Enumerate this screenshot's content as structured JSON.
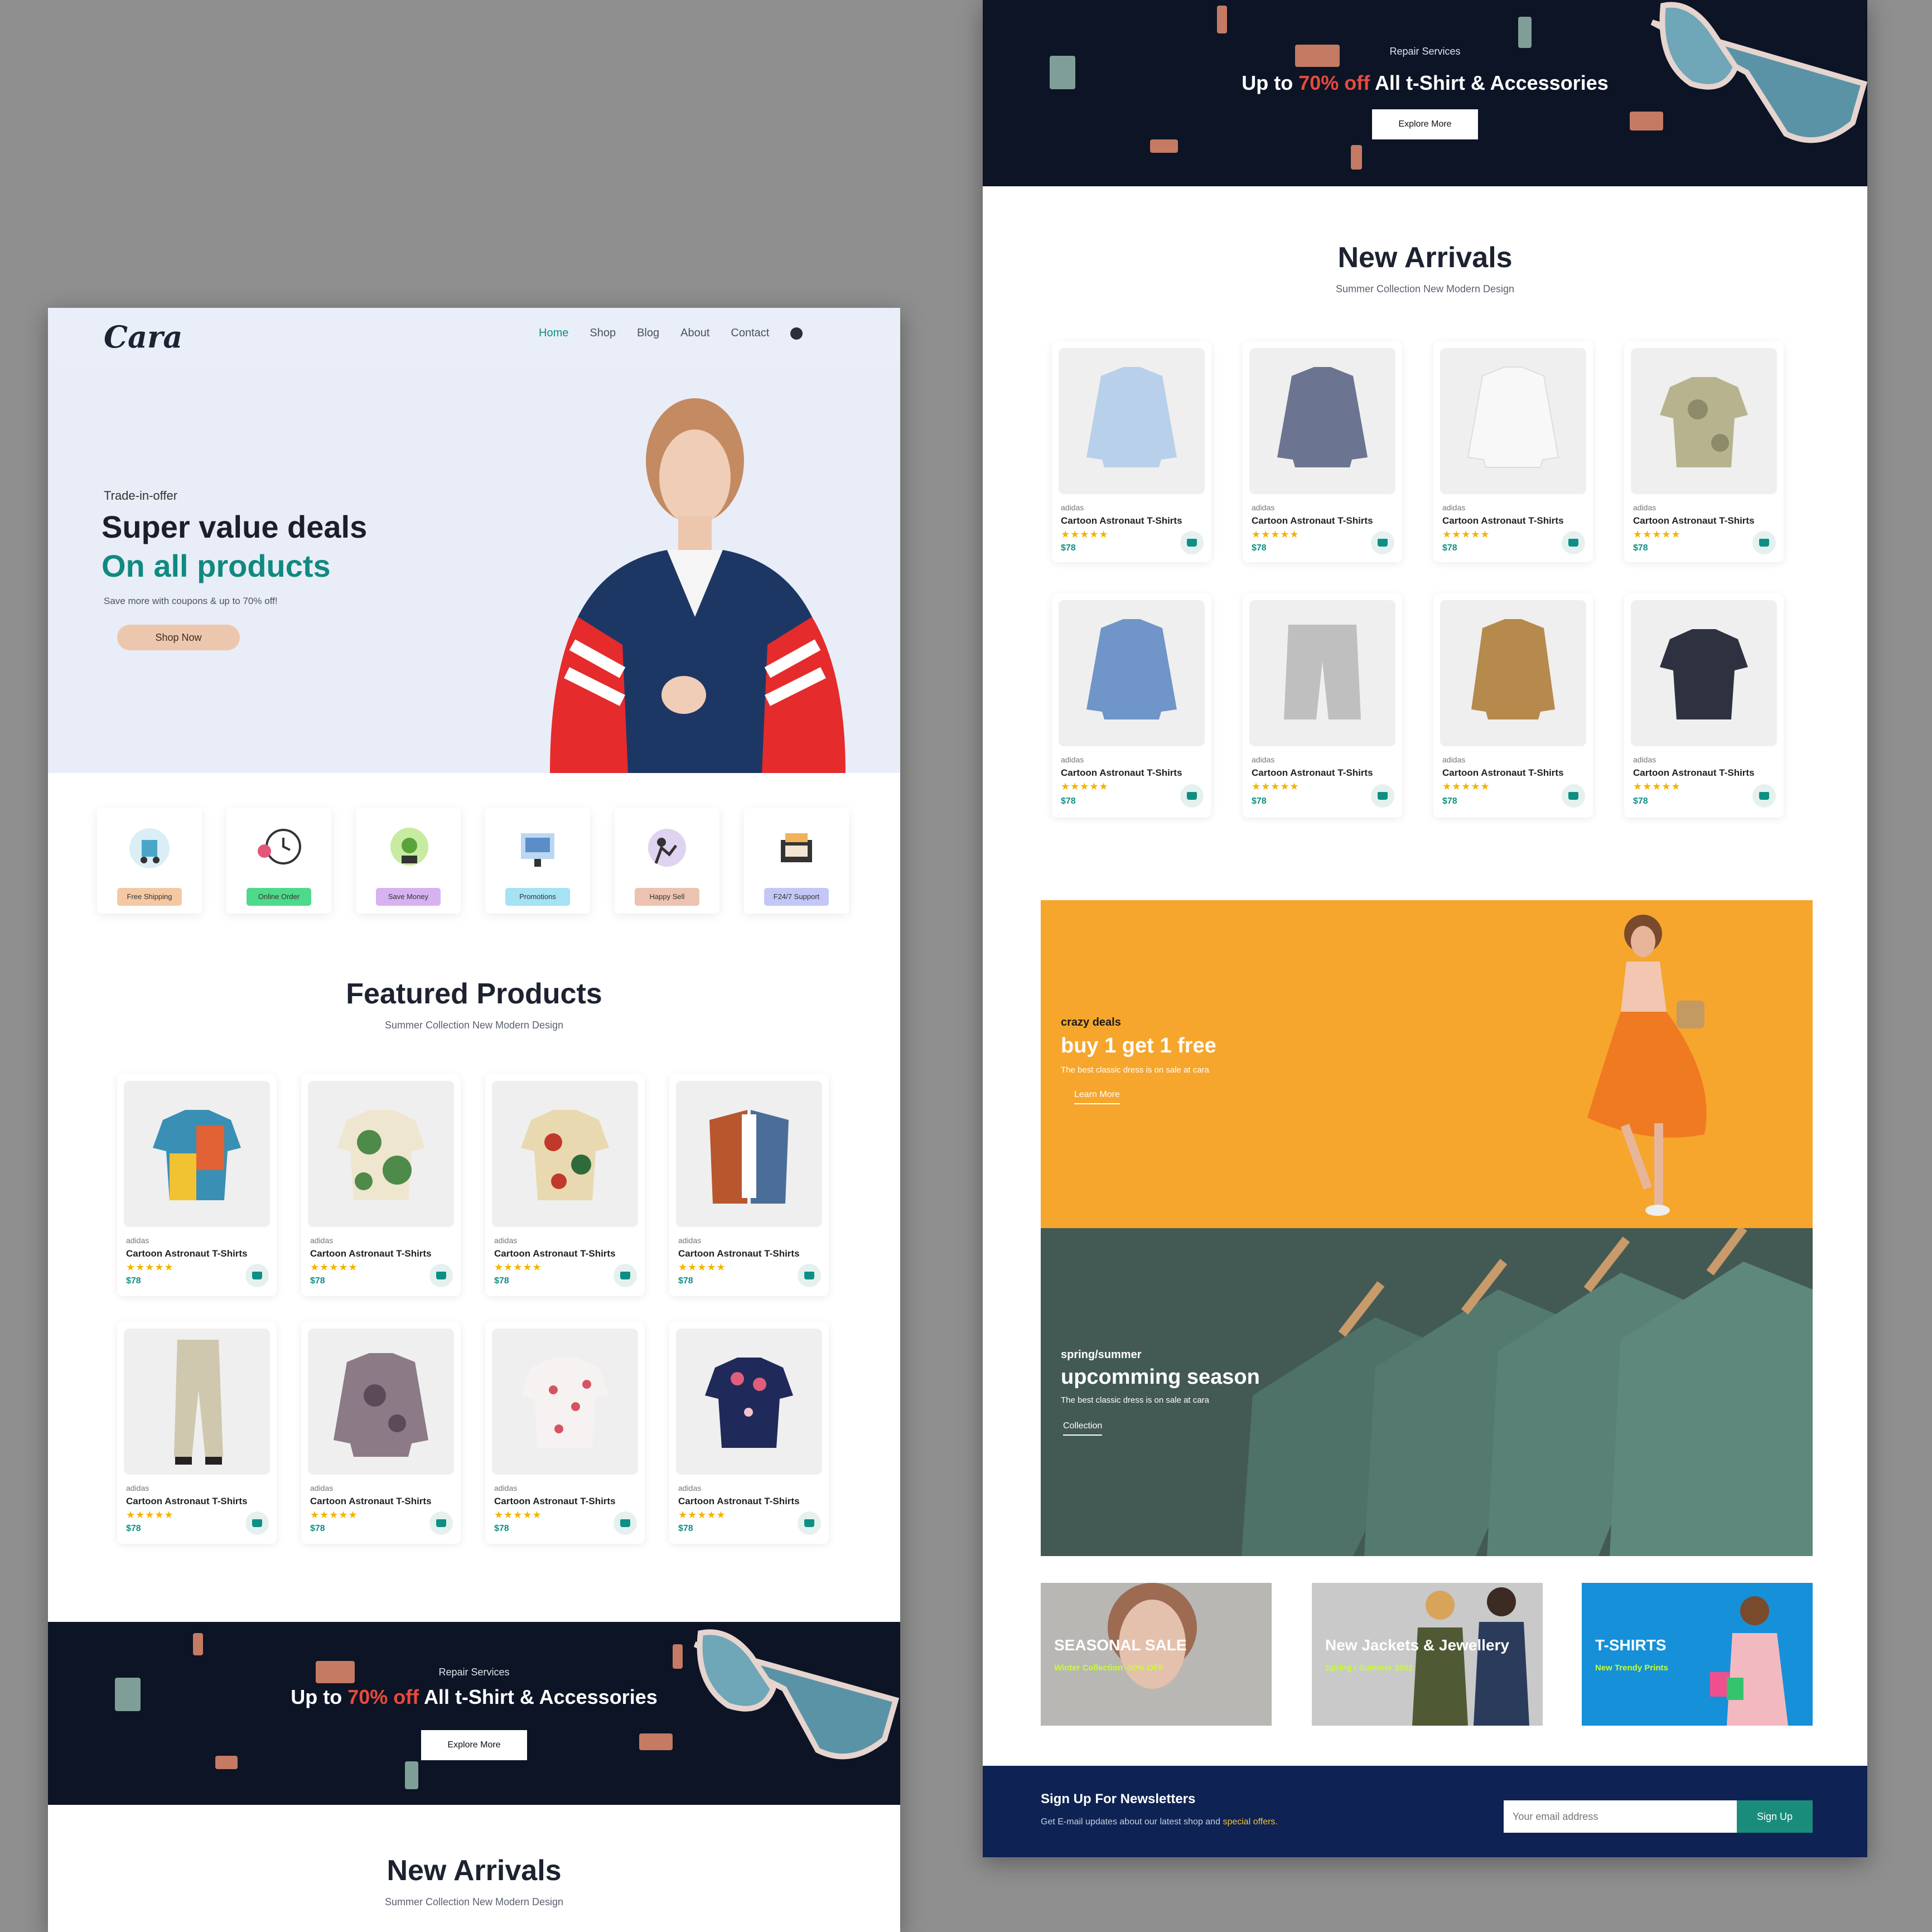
{
  "header": {
    "logo": "Cara",
    "nav": [
      "Home",
      "Shop",
      "Blog",
      "About",
      "Contact"
    ]
  },
  "hero": {
    "eyebrow": "Trade-in-offer",
    "title_line1": "Super value deals",
    "title_line2": "On all products",
    "subtitle": "Save more with coupons & up to 70% off!",
    "button": "Shop Now"
  },
  "categories": [
    {
      "label": "Free Shipping",
      "color": "#fddde4"
    },
    {
      "label": "Online Order",
      "color": "#cdebbc"
    },
    {
      "label": "Save Money",
      "color": "#d1e8f2"
    },
    {
      "label": "Promotions",
      "color": "#cdd4f8"
    },
    {
      "label": "Happy Sell",
      "color": "#f6dbf6"
    },
    {
      "label": "F24/7 Support",
      "color": "#fff2e5"
    }
  ],
  "featured": {
    "title": "Featured Products",
    "subtitle": "Summer Collection New Modern Design",
    "products": [
      {
        "brand": "adidas",
        "name": "Cartoon Astronaut T-Shirts",
        "stars": "★★★★★",
        "price": "$78"
      },
      {
        "brand": "adidas",
        "name": "Cartoon Astronaut T-Shirts",
        "stars": "★★★★★",
        "price": "$78"
      },
      {
        "brand": "adidas",
        "name": "Cartoon Astronaut T-Shirts",
        "stars": "★★★★★",
        "price": "$78"
      },
      {
        "brand": "adidas",
        "name": "Cartoon Astronaut T-Shirts",
        "stars": "★★★★★",
        "price": "$78"
      },
      {
        "brand": "adidas",
        "name": "Cartoon Astronaut T-Shirts",
        "stars": "★★★★★",
        "price": "$78"
      },
      {
        "brand": "adidas",
        "name": "Cartoon Astronaut T-Shirts",
        "stars": "★★★★★",
        "price": "$78"
      },
      {
        "brand": "adidas",
        "name": "Cartoon Astronaut T-Shirts",
        "stars": "★★★★★",
        "price": "$78"
      },
      {
        "brand": "adidas",
        "name": "Cartoon Astronaut T-Shirts",
        "stars": "★★★★★",
        "price": "$78"
      }
    ]
  },
  "banner": {
    "eyebrow": "Repair Services",
    "head_prefix": "Up to",
    "head_highlight": "70% off",
    "head_suffix": "All t-Shirt & Accessories",
    "button": "Explore More"
  },
  "arrivals": {
    "title": "New Arrivals",
    "subtitle": "Summer Collection New Modern Design",
    "products": [
      {
        "brand": "adidas",
        "name": "Cartoon Astronaut T-Shirts",
        "stars": "★★★★★",
        "price": "$78"
      },
      {
        "brand": "adidas",
        "name": "Cartoon Astronaut T-Shirts",
        "stars": "★★★★★",
        "price": "$78"
      },
      {
        "brand": "adidas",
        "name": "Cartoon Astronaut T-Shirts",
        "stars": "★★★★★",
        "price": "$78"
      },
      {
        "brand": "adidas",
        "name": "Cartoon Astronaut T-Shirts",
        "stars": "★★★★★",
        "price": "$78"
      },
      {
        "brand": "adidas",
        "name": "Cartoon Astronaut T-Shirts",
        "stars": "★★★★★",
        "price": "$78"
      },
      {
        "brand": "adidas",
        "name": "Cartoon Astronaut T-Shirts",
        "stars": "★★★★★",
        "price": "$78"
      },
      {
        "brand": "adidas",
        "name": "Cartoon Astronaut T-Shirts",
        "stars": "★★★★★",
        "price": "$78"
      },
      {
        "brand": "adidas",
        "name": "Cartoon Astronaut T-Shirts",
        "stars": "★★★★★",
        "price": "$78"
      }
    ]
  },
  "promo1": {
    "eyebrow": "crazy deals",
    "title": "buy 1 get 1 free",
    "subtitle": "The best classic dress is on sale at cara",
    "link": "Learn More"
  },
  "promo2": {
    "eyebrow": "spring/summer",
    "title": "upcomming season",
    "subtitle": "The best classic dress is on sale at cara",
    "link": "Collection"
  },
  "tiles": [
    {
      "title": "SEASONAL SALE",
      "sub": "Winter Collection -50% OFF"
    },
    {
      "title": "New Jackets & Jewellery",
      "sub": "Spring / Summer 2022"
    },
    {
      "title": "T-SHIRTS",
      "sub": "New Trendy Prints"
    }
  ],
  "newsletter": {
    "title": "Sign Up For Newsletters",
    "sub_prefix": "Get E-mail updates about our latest shop and",
    "sub_highlight": "special offers.",
    "placeholder": "Your email address",
    "button": "Sign Up"
  },
  "colors": {
    "accent": "#0d8f85",
    "banner_bg": "#0c1426",
    "newsletter_bg": "#0e2353",
    "promo_orange": "#f6a62c",
    "sale_red": "#e84a3c"
  }
}
